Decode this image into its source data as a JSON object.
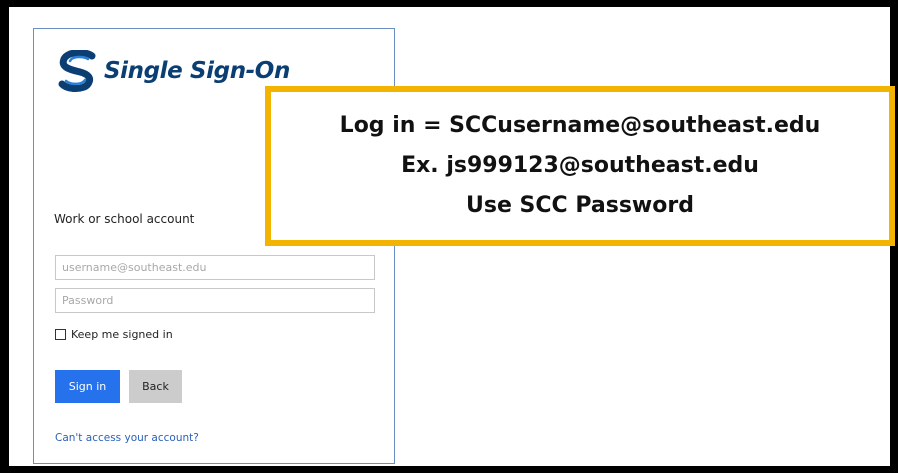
{
  "brand": {
    "name": "Single Sign-On",
    "logo_icon": "sso-s-logo-icon",
    "color": "#0b3f73",
    "accent": "#2a7fd6"
  },
  "form": {
    "section_label": "Work or school account",
    "username_placeholder": "username@southeast.edu",
    "password_placeholder": "Password",
    "keep_signed_in_label": "Keep me signed in",
    "keep_signed_in_checked": false,
    "signin_label": "Sign in",
    "back_label": "Back",
    "help_link": "Can't access your account?"
  },
  "callout": {
    "lines": [
      "Log in = SCCusername@southeast.edu",
      "Ex. js999123@southeast.edu",
      "Use SCC Password"
    ],
    "border_color": "#f2b400"
  },
  "colors": {
    "primary_button": "#2672ec",
    "secondary_button": "#cccccc",
    "link": "#2a62b8"
  }
}
